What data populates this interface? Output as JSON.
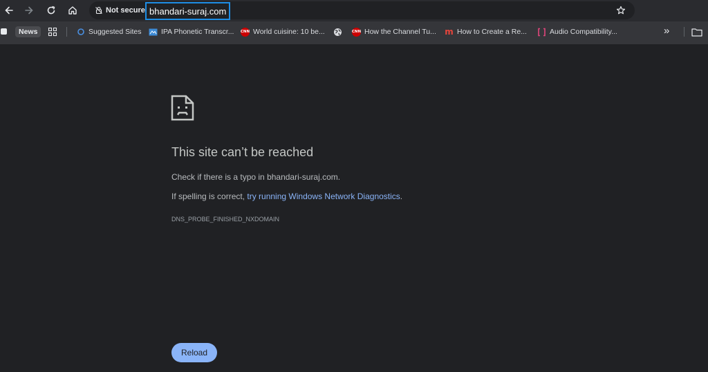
{
  "toolbar": {
    "security_label": "Not secure",
    "url": "bhandari-suraj.com"
  },
  "bookmarks": {
    "news_label": "News",
    "items": [
      {
        "label": "Suggested Sites",
        "icon": "suggested-sites-icon"
      },
      {
        "label": "IPA Phonetic Transcr...",
        "icon": "ipa-icon"
      },
      {
        "label": "World cuisine: 10 be...",
        "icon": "cnn-icon"
      },
      {
        "label": "",
        "icon": "globe-icon"
      },
      {
        "label": "How the Channel Tu...",
        "icon": "cnn-icon"
      },
      {
        "label": "How to Create a Re...",
        "icon": "m-icon"
      },
      {
        "label": "Audio Compatibility...",
        "icon": "bracket-icon"
      }
    ],
    "more_label": "»"
  },
  "error_page": {
    "title": "This site can’t be reached",
    "line1": "Check if there is a typo in bhandari-suraj.com.",
    "line2_prefix": "If spelling is correct, ",
    "line2_link": "try running Windows Network Diagnostics",
    "line2_suffix": ".",
    "error_code": "DNS_PROBE_FINISHED_NXDOMAIN",
    "reload_label": "Reload"
  },
  "colors": {
    "page_background": "#202124",
    "link": "#8ab4f8",
    "url_highlight": "#1e8ee6"
  }
}
